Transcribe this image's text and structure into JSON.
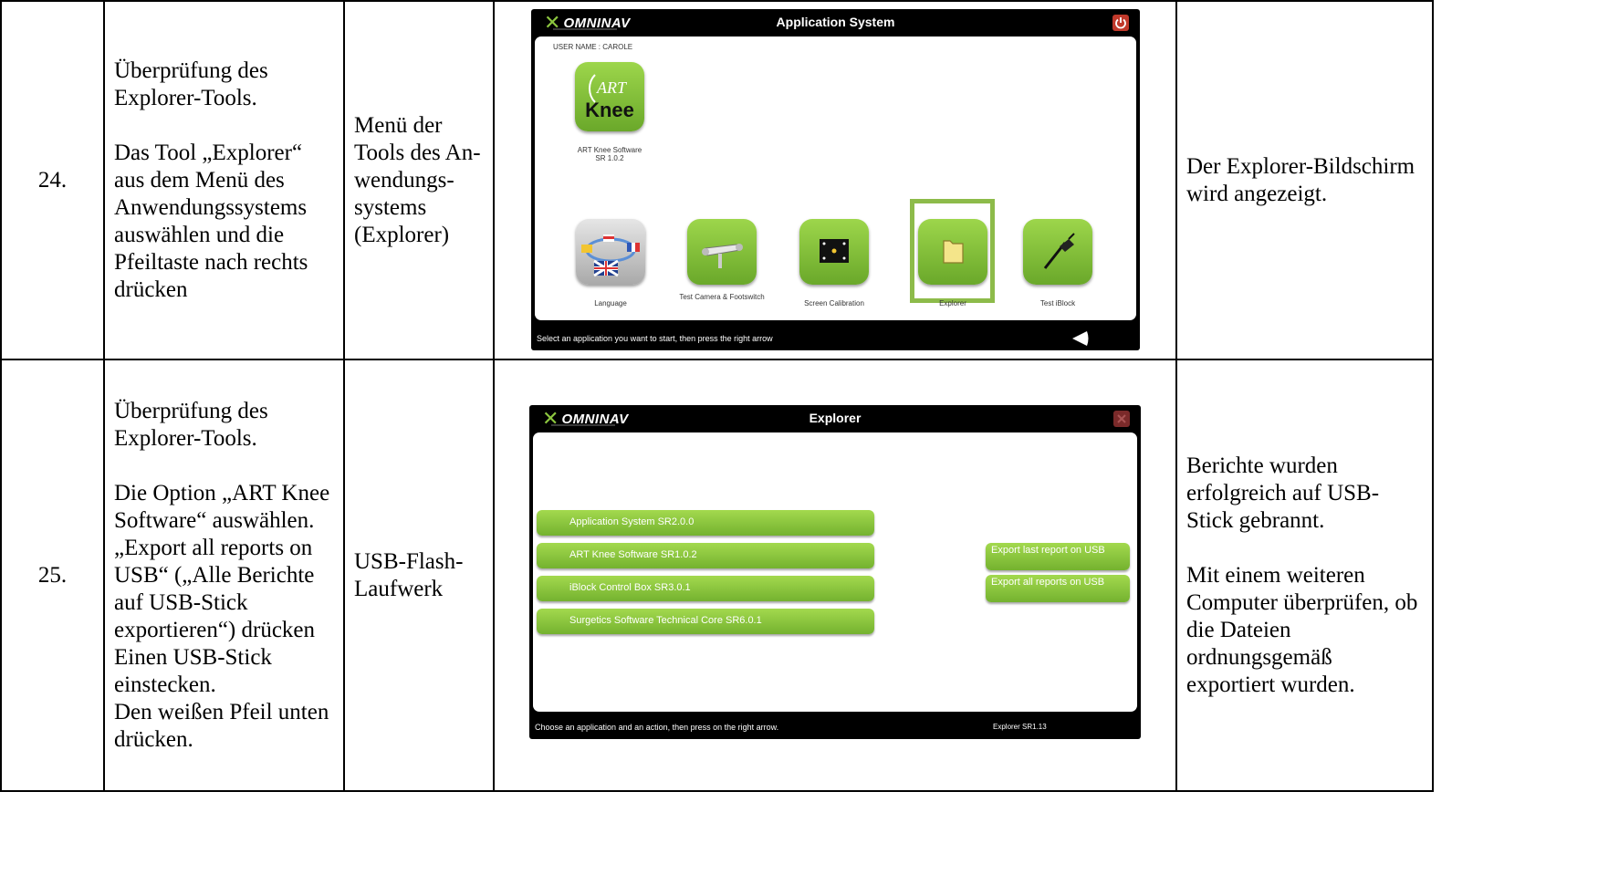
{
  "rows": [
    {
      "number": "24.",
      "procedure": [
        "Überprüfung des Explorer-Tools.",
        "Das Tool „Explorer“ aus dem Menü des Anwendungssystems auswählen und die Pfeiltaste nach rechts drücken"
      ],
      "location": "Menü der Tools des An-wendungs-systems (Explorer)",
      "expected": "Der Explorer-Bildschirm wird angezeigt."
    },
    {
      "number": "25.",
      "procedure": [
        "Überprüfung des Explorer-Tools.",
        "Die Option „ART Knee Software“ auswählen.",
        "„Export all reports on USB“ („Alle Berichte auf USB-Stick exportieren“) drücken",
        "Einen USB-Stick einstecken.",
        "Den weißen Pfeil unten drücken."
      ],
      "location": "USB-Flash-Laufwerk",
      "expected": [
        "Berichte wurden erfolgreich auf USB-Stick gebrannt.",
        "Mit einem weiteren Computer überprüfen, ob die Dateien ordnungsgemäß exportiert wurden."
      ]
    }
  ],
  "app_system_screen": {
    "brand": "OMNINAV",
    "title": "Application System",
    "user_label": "USER NAME : CAROLE",
    "art_knee": {
      "logo_top": "ART",
      "logo_bottom": "Knee",
      "label_line1": "ART Knee Software",
      "label_line2": "SR 1.0.2"
    },
    "tools": [
      {
        "label": "Language",
        "icon": "flags-icon"
      },
      {
        "label": "Test Camera & Footswitch",
        "icon": "camera-icon"
      },
      {
        "label": "Screen Calibration",
        "icon": "calibration-icon"
      },
      {
        "label": "Explorer",
        "icon": "folder-icon",
        "selected": true
      },
      {
        "label": "Test iBlock",
        "icon": "iblock-icon"
      }
    ],
    "status": "Select an application you want to start, then press the right arrow",
    "colors": {
      "accent": "#8cc63f",
      "selection": "#8dbb4a",
      "power_button": "#c0392b"
    }
  },
  "explorer_screen": {
    "brand": "OMNINAV",
    "title": "Explorer",
    "applications": [
      "Application System SR2.0.0",
      "ART Knee Software SR1.0.2",
      "iBlock Control Box SR3.0.1",
      "Surgetics Software Technical Core SR6.0.1"
    ],
    "actions": [
      "Export last report on USB",
      "Export all reports on USB"
    ],
    "status": "Choose an application and an action, then press on the right arrow.",
    "version": "Explorer  SR1.13"
  }
}
